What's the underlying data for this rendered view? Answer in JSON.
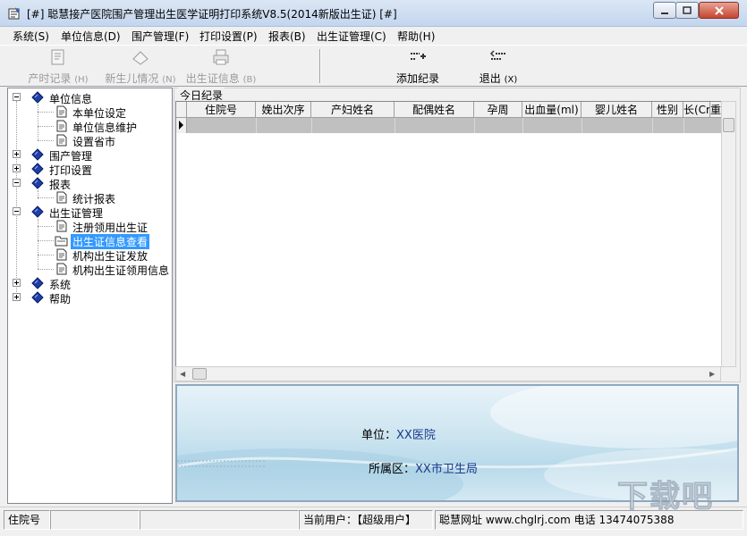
{
  "window": {
    "title": "[#] 聪慧接产医院围产管理出生医学证明打印系统V8.5(2014新版出生证) [#]"
  },
  "menu": [
    "系统(S)",
    "单位信息(D)",
    "围产管理(F)",
    "打印设置(P)",
    "报表(B)",
    "出生证管理(C)",
    "帮助(H)"
  ],
  "toolbar": {
    "delivery_record": "产时记录",
    "delivery_record_key": "(H)",
    "newborn": "新生儿情况",
    "newborn_key": "(N)",
    "birth_cert_info": "出生证信息",
    "birth_cert_info_key": "(B)",
    "add_record": "添加纪录",
    "exit": "退出",
    "exit_key": "(X)"
  },
  "tree": {
    "unit_info": "单位信息",
    "unit_settings": "本单位设定",
    "unit_maintenance": "单位信息维护",
    "province_city": "设置省市",
    "perinatal": "围产管理",
    "print_settings": "打印设置",
    "reports": "报表",
    "stats_report": "统计报表",
    "cert_mgmt": "出生证管理",
    "register_cert": "注册领用出生证",
    "cert_query": "出生证信息查看",
    "org_cert_issue": "机构出生证发放",
    "org_cert_receive": "机构出生证领用信息",
    "system": "系统",
    "help": "帮助"
  },
  "grid": {
    "group_label": "今日纪录",
    "columns": [
      "住院号",
      "娩出次序",
      "产妇姓名",
      "配偶姓名",
      "孕周",
      "出血量(ml)",
      "婴儿姓名",
      "性别",
      "长(Cm",
      "重"
    ]
  },
  "banner": {
    "unit_label": "单位：",
    "unit_value": "XX医院",
    "district_label": "所属区：",
    "district_value": "XX市卫生局"
  },
  "status": {
    "field": "住院号",
    "current_user": "当前用户：【超级用户】",
    "website": "聪慧网址  www.chglrj.com  电话 13474075388"
  },
  "watermark": "下载吧"
}
